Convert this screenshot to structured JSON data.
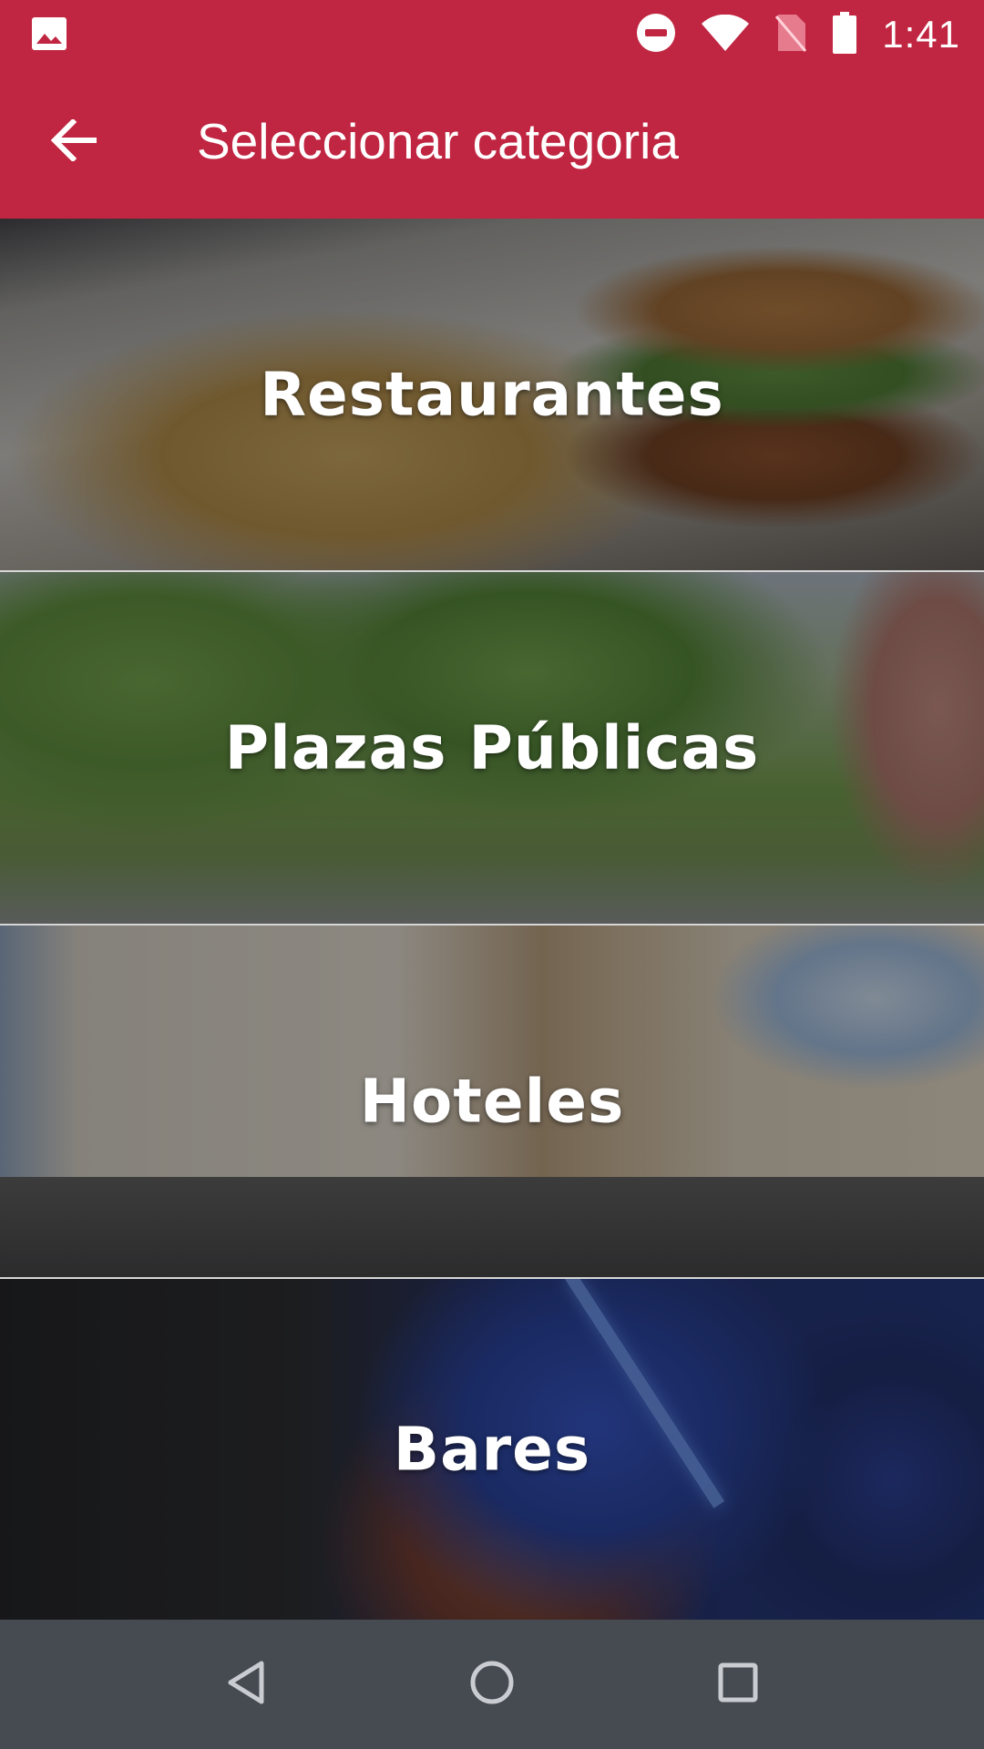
{
  "status_bar": {
    "time": "1:41",
    "icons": [
      "image-icon",
      "do-not-disturb-icon",
      "wifi-icon",
      "no-sim-icon",
      "battery-icon"
    ]
  },
  "app_bar": {
    "title": "Seleccionar categoria",
    "back_icon": "arrow-back-icon",
    "background_color": "#c02541"
  },
  "categories": [
    {
      "label": "Restaurantes"
    },
    {
      "label": "Plazas Públicas"
    },
    {
      "label": "Hoteles"
    },
    {
      "label": "Bares"
    }
  ],
  "nav_bar": {
    "buttons": [
      "back-triangle-icon",
      "home-circle-icon",
      "recents-square-icon"
    ],
    "background_color": "#464b52"
  }
}
